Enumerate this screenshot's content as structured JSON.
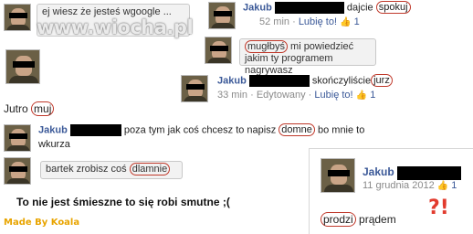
{
  "watermark": "www.wiocha.pl",
  "messages": [
    {
      "text": "ej wiesz że jesteś wgoogle",
      "suffix": "..."
    },
    {
      "author": "Jakub",
      "text_after": "dajcie",
      "circled": "spokuj",
      "time": "52 min",
      "like": "Lubię to!",
      "likes": "1"
    },
    {
      "circled": "mugłbyś",
      "text": "mi powiedzieć jakim ty programem nagrywasz"
    },
    {
      "author": "Jakub",
      "text_after": "skończyliście",
      "circled": "jurz",
      "time": "33 min",
      "edited": "Edytowany",
      "like": "Lubię to!",
      "likes": "1"
    },
    {
      "prefix": "Jutro",
      "circled": "muj"
    },
    {
      "author": "Jakub",
      "text_before": "poza tym jak coś chcesz to napisz",
      "circled": "domne",
      "text_after": "bo mnie to",
      "line2": "wkurza"
    },
    {
      "text": "bartek zrobisz coś",
      "circled": "dlamnie"
    }
  ],
  "caption": "To nie jest śmieszne to się robi smutne ;(",
  "credit": "Made By Koala",
  "card": {
    "author": "Jakub",
    "date": "11 grudnia 2012",
    "likes": "1",
    "circled": "prodzi",
    "text_after": "prądem",
    "exclaim": "?!"
  }
}
